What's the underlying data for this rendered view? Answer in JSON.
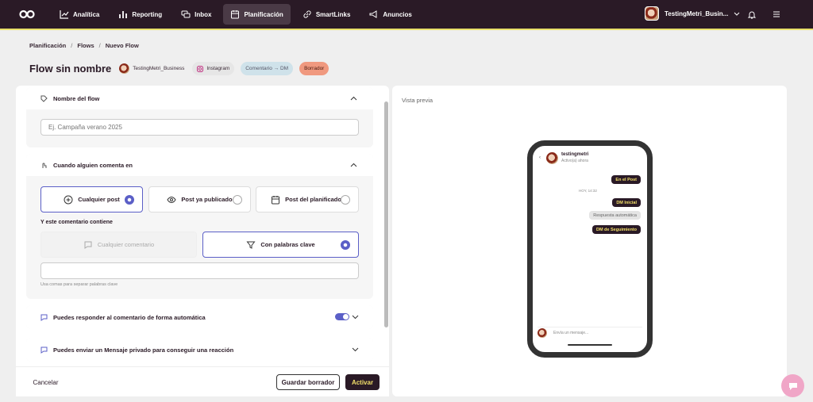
{
  "nav": {
    "items": [
      {
        "label": "Analítica",
        "icon": "chart-line-icon"
      },
      {
        "label": "Reporting",
        "icon": "bar-chart-icon"
      },
      {
        "label": "Inbox",
        "icon": "chat-icon"
      },
      {
        "label": "Planificación",
        "icon": "calendar-icon"
      },
      {
        "label": "SmartLinks",
        "icon": "link-icon"
      },
      {
        "label": "Anuncios",
        "icon": "megaphone-icon"
      }
    ],
    "account": "TestingMetri_Busin..."
  },
  "breadcrumb": [
    "Planificación",
    "Flows",
    "Nuevo Flow"
  ],
  "header": {
    "title": "Flow sin nombre",
    "account_chip": "TestingMetri_Business",
    "platform_chip": "Instagram",
    "type_chip": "Comentario → DM",
    "status_chip": "Borrador"
  },
  "sections": {
    "name": {
      "title": "Nombre del flow",
      "placeholder": "Ej. Campaña verano 2025"
    },
    "trigger": {
      "title": "Cuando alguien comenta en",
      "options": [
        "Cualquier post",
        "Post ya publicado",
        "Post del planificador"
      ],
      "selected": "Cualquier post",
      "contains_label": "Y este comentario contiene",
      "contains_options": [
        "Cualquier comentario",
        "Con palabras clave"
      ],
      "contains_selected": "Con palabras clave",
      "keywords_hint": "Usa comas para separar palabras clave"
    },
    "auto_reply": {
      "title": "Puedes responder al comentario de forma automática",
      "enabled": true
    },
    "private_msg": {
      "title": "Puedes enviar un Mensaje privado para conseguir una reacción"
    }
  },
  "footer": {
    "cancel": "Cancelar",
    "save": "Guardar borrador",
    "activate": "Activar"
  },
  "preview": {
    "label": "Vista previa",
    "profile": "testingmetri",
    "status": "Activo(a) ahora",
    "post_tag": "En el Post",
    "time": "HOY, 14:32",
    "dm_initial": "DM Inicial",
    "auto_reply": "Respuesta automática",
    "followup": "DM de Seguimiento",
    "input_placeholder": "Envía un mensaje..."
  },
  "colors": {
    "topbar": "#2a1a26",
    "accent": "#5b5fc7",
    "draft": "#f0997f",
    "highlight": "#f3e06a"
  }
}
